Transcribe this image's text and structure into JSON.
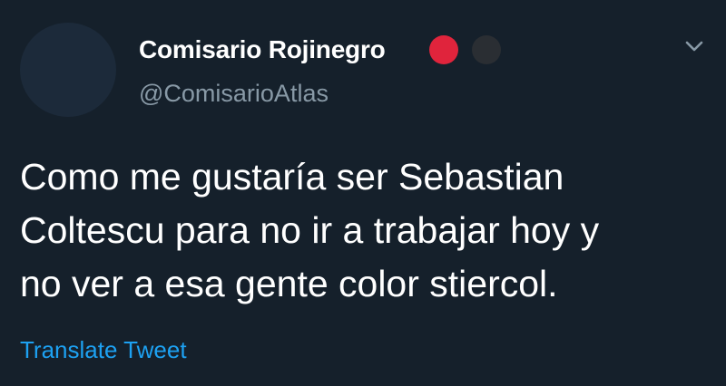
{
  "tweet": {
    "author": {
      "display_name": "Comisario Rojinegro",
      "handle": "@ComisarioAtlas",
      "badge_colors": [
        "#e0243c",
        "#2a2e33"
      ]
    },
    "text_lines": [
      "Como me gustaría ser Sebastian",
      "Coltescu para no ir a trabajar hoy y",
      "no ver a esa gente color stiercol."
    ],
    "translate_label": "Translate Tweet",
    "icons": {
      "menu": "chevron-down-icon"
    }
  }
}
